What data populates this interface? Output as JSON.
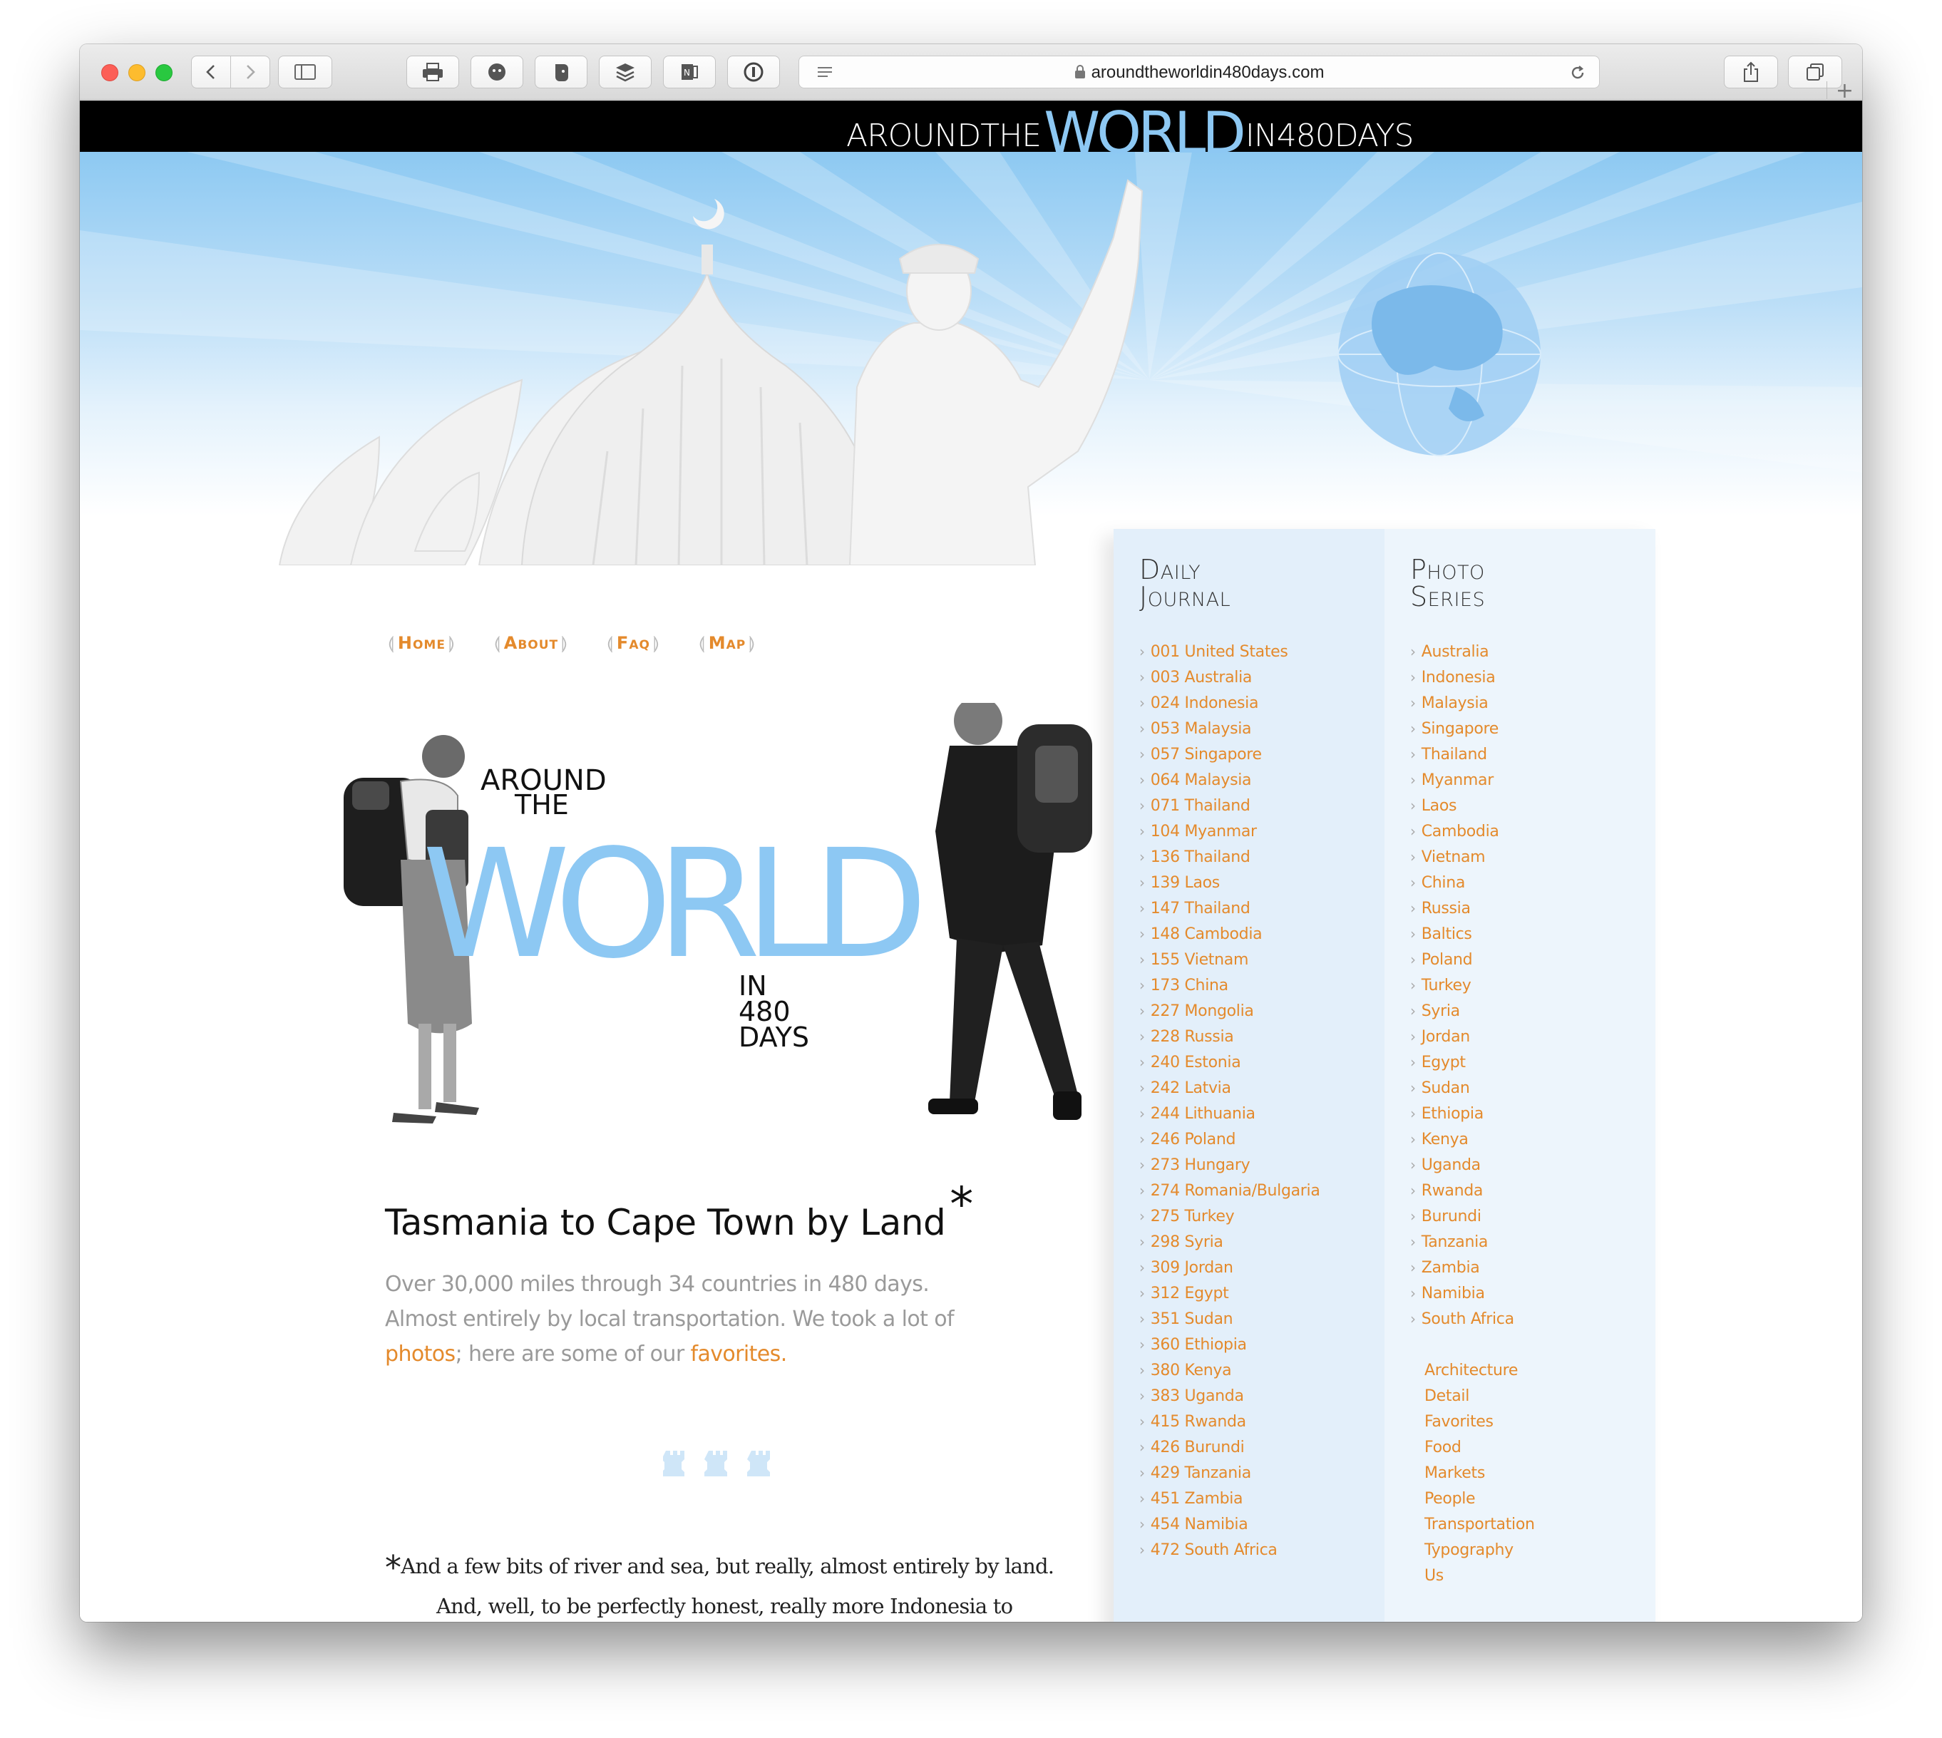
{
  "browser": {
    "url": "aroundtheworldin480days.com",
    "tab_plus": "+"
  },
  "site": {
    "logo": {
      "around_the": "AROUNDTHE",
      "world": "WORLD",
      "in_days": "IN480DAYS"
    },
    "nav": [
      "Home",
      "About",
      "Faq",
      "Map"
    ],
    "illustration": {
      "around": "AROUND",
      "the": "THE",
      "world": "WORLD",
      "in": "IN",
      "num": "480",
      "days": "DAYS"
    },
    "headline": "Tasmania to Cape Town by Land",
    "headline_mark": "*",
    "intro": {
      "text1": "Over 30,000 miles through 34 countries in 480 days. Almost entirely by local transportation. We took a lot of ",
      "link_photos": "photos",
      "text2": "; here are some of our ",
      "link_favorites": "favorites",
      "text3": "."
    },
    "footnote": {
      "mark": "*",
      "line1": "And a few bits of river and sea, but really, almost entirely by land.",
      "line2": "And, well, to be perfectly honest, really more Indonesia to South Africa by surface as a flight from Perth to Bali was needed to get up and out of the Land Down Under."
    },
    "colors": {
      "accent": "#e48a2c",
      "sky": "#8dc8f3",
      "sidebar_left": "#e3effa",
      "sidebar_right": "#edf5fc"
    }
  },
  "sidebar": {
    "journal": {
      "title_line1": "Daily",
      "title_line2": "Journal",
      "items": [
        "001 United States",
        "003 Australia",
        "024 Indonesia",
        "053 Malaysia",
        "057 Singapore",
        "064 Malaysia",
        "071 Thailand",
        "104 Myanmar",
        "136 Thailand",
        "139 Laos",
        "147 Thailand",
        "148 Cambodia",
        "155 Vietnam",
        "173 China",
        "227 Mongolia",
        "228 Russia",
        "240 Estonia",
        "242 Latvia",
        "244 Lithuania",
        "246 Poland",
        "273 Hungary",
        "274 Romania/Bulgaria",
        "275 Turkey",
        "298 Syria",
        "309 Jordan",
        "312 Egypt",
        "351 Sudan",
        "360 Ethiopia",
        "380 Kenya",
        "383 Uganda",
        "415 Rwanda",
        "426 Burundi",
        "429 Tanzania",
        "451 Zambia",
        "454 Namibia",
        "472 South Africa"
      ]
    },
    "photo": {
      "title_line1": "Photo",
      "title_line2": "Series",
      "countries": [
        "Australia",
        "Indonesia",
        "Malaysia",
        "Singapore",
        "Thailand",
        "Myanmar",
        "Laos",
        "Cambodia",
        "Vietnam",
        "China",
        "Russia",
        "Baltics",
        "Poland",
        "Turkey",
        "Syria",
        "Jordan",
        "Egypt",
        "Sudan",
        "Ethiopia",
        "Kenya",
        "Uganda",
        "Rwanda",
        "Burundi",
        "Tanzania",
        "Zambia",
        "Namibia",
        "South Africa"
      ],
      "themes": [
        "Architecture",
        "Detail",
        "Favorites",
        "Food",
        "Markets",
        "People",
        "Transportation",
        "Typography",
        "Us"
      ]
    }
  }
}
